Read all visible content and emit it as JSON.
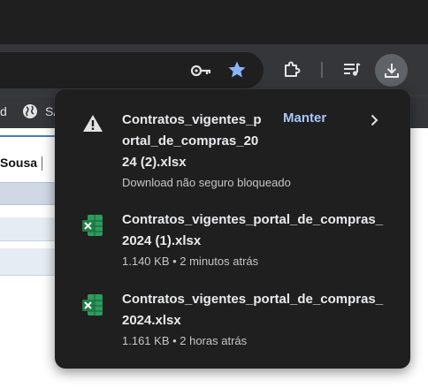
{
  "browser": {
    "toolbar_icons": [
      "key-icon",
      "star-icon",
      "extensions-icon",
      "reading-list-icon",
      "download-icon"
    ],
    "bookmarks": {
      "fragment_left": "d",
      "fragment_s": "SA"
    },
    "star_color": "#8ab4f8"
  },
  "page": {
    "text_sousa": "Sousa"
  },
  "downloads": {
    "items": [
      {
        "icon": "warning-icon",
        "name_lines": [
          "Contratos_vigentes_p",
          "ortal_de_compras_20",
          "24 (2).xlsx"
        ],
        "status": "Download não seguro bloqueado",
        "action": "Manter"
      },
      {
        "icon": "excel-file-icon",
        "name_lines": [
          "Contratos_vigentes_portal_de_compras_",
          "2024 (1).xlsx"
        ],
        "status": "1.140 KB • 2 minutos atrás"
      },
      {
        "icon": "excel-file-icon",
        "name_lines": [
          "Contratos_vigentes_portal_de_compras_",
          "2024.xlsx"
        ],
        "status": "1.161 KB • 2 horas atrás"
      }
    ]
  },
  "colors": {
    "panel_bg": "#1f1f1f",
    "action": "#a8c7fa",
    "excel_green": "#1e7e45"
  }
}
